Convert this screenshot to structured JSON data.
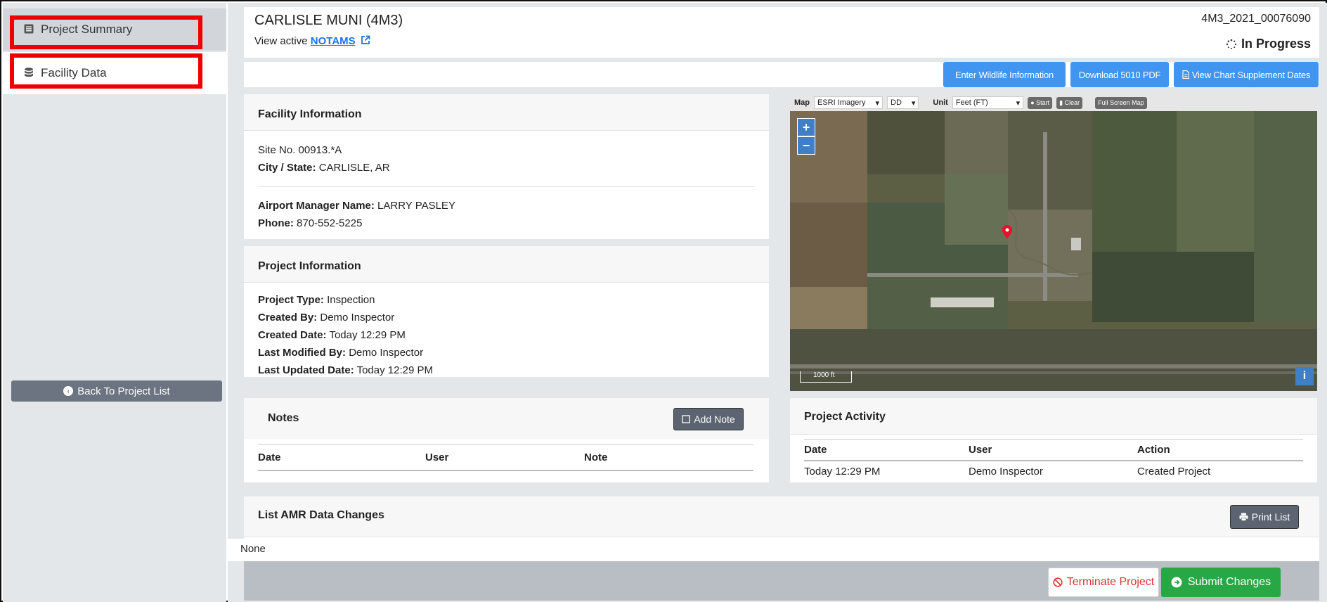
{
  "sidebar": {
    "items": [
      {
        "label": "Project Summary",
        "icon": "list-alt-icon"
      },
      {
        "label": "Facility Data",
        "icon": "database-icon"
      }
    ],
    "back_label": "Back To Project List"
  },
  "header": {
    "title": "CARLISLE MUNI (4M3)",
    "view_active_text": "View active",
    "notams_link": "NOTAMS",
    "project_id": "4M3_2021_00076090",
    "status": "In Progress"
  },
  "toolbar": {
    "wildlife_label": "Enter Wildlife Information",
    "download_label": "Download 5010 PDF",
    "chart_supplement_label": "View Chart Supplement Dates"
  },
  "facility": {
    "heading": "Facility Information",
    "site_no": "Site No. 00913.*A",
    "city_state_label": "City / State:",
    "city_state": "CARLISLE, AR",
    "manager_label": "Airport Manager Name:",
    "manager": "LARRY PASLEY",
    "phone_label": "Phone:",
    "phone": "870-552-5225"
  },
  "project": {
    "heading": "Project Information",
    "type_label": "Project Type:",
    "type": "Inspection",
    "created_by_label": "Created By:",
    "created_by": "Demo Inspector",
    "created_date_label": "Created Date:",
    "created_date": "Today 12:29 PM",
    "modified_by_label": "Last Modified By:",
    "modified_by": "Demo Inspector",
    "updated_date_label": "Last Updated Date:",
    "updated_date": "Today 12:29 PM"
  },
  "map": {
    "map_label": "Map",
    "basemap": "ESRI Imagery",
    "coord_format": "DD",
    "unit_label": "Unit",
    "unit": "Feet (FT)",
    "start_label": "Start",
    "clear_label": "Clear",
    "fullscreen_label": "Full Screen Map",
    "zoom_in": "+",
    "zoom_out": "−",
    "scale_label": "1000 ft",
    "info_label": "i"
  },
  "notes": {
    "heading": "Notes",
    "add_label": "Add Note",
    "columns": [
      "Date",
      "User",
      "Note"
    ]
  },
  "activity": {
    "heading": "Project Activity",
    "columns": [
      "Date",
      "User",
      "Action"
    ],
    "rows": [
      [
        "Today 12:29 PM",
        "Demo Inspector",
        "Created Project"
      ]
    ]
  },
  "amr": {
    "heading": "List AMR Data Changes",
    "print_label": "Print List",
    "empty_text": "None"
  },
  "footer": {
    "terminate_label": "Terminate Project",
    "submit_label": "Submit Changes"
  },
  "colors": {
    "primary": "#3f95f0",
    "success": "#28a745",
    "danger": "#dd3333",
    "highlight_box": "#ee0000"
  }
}
